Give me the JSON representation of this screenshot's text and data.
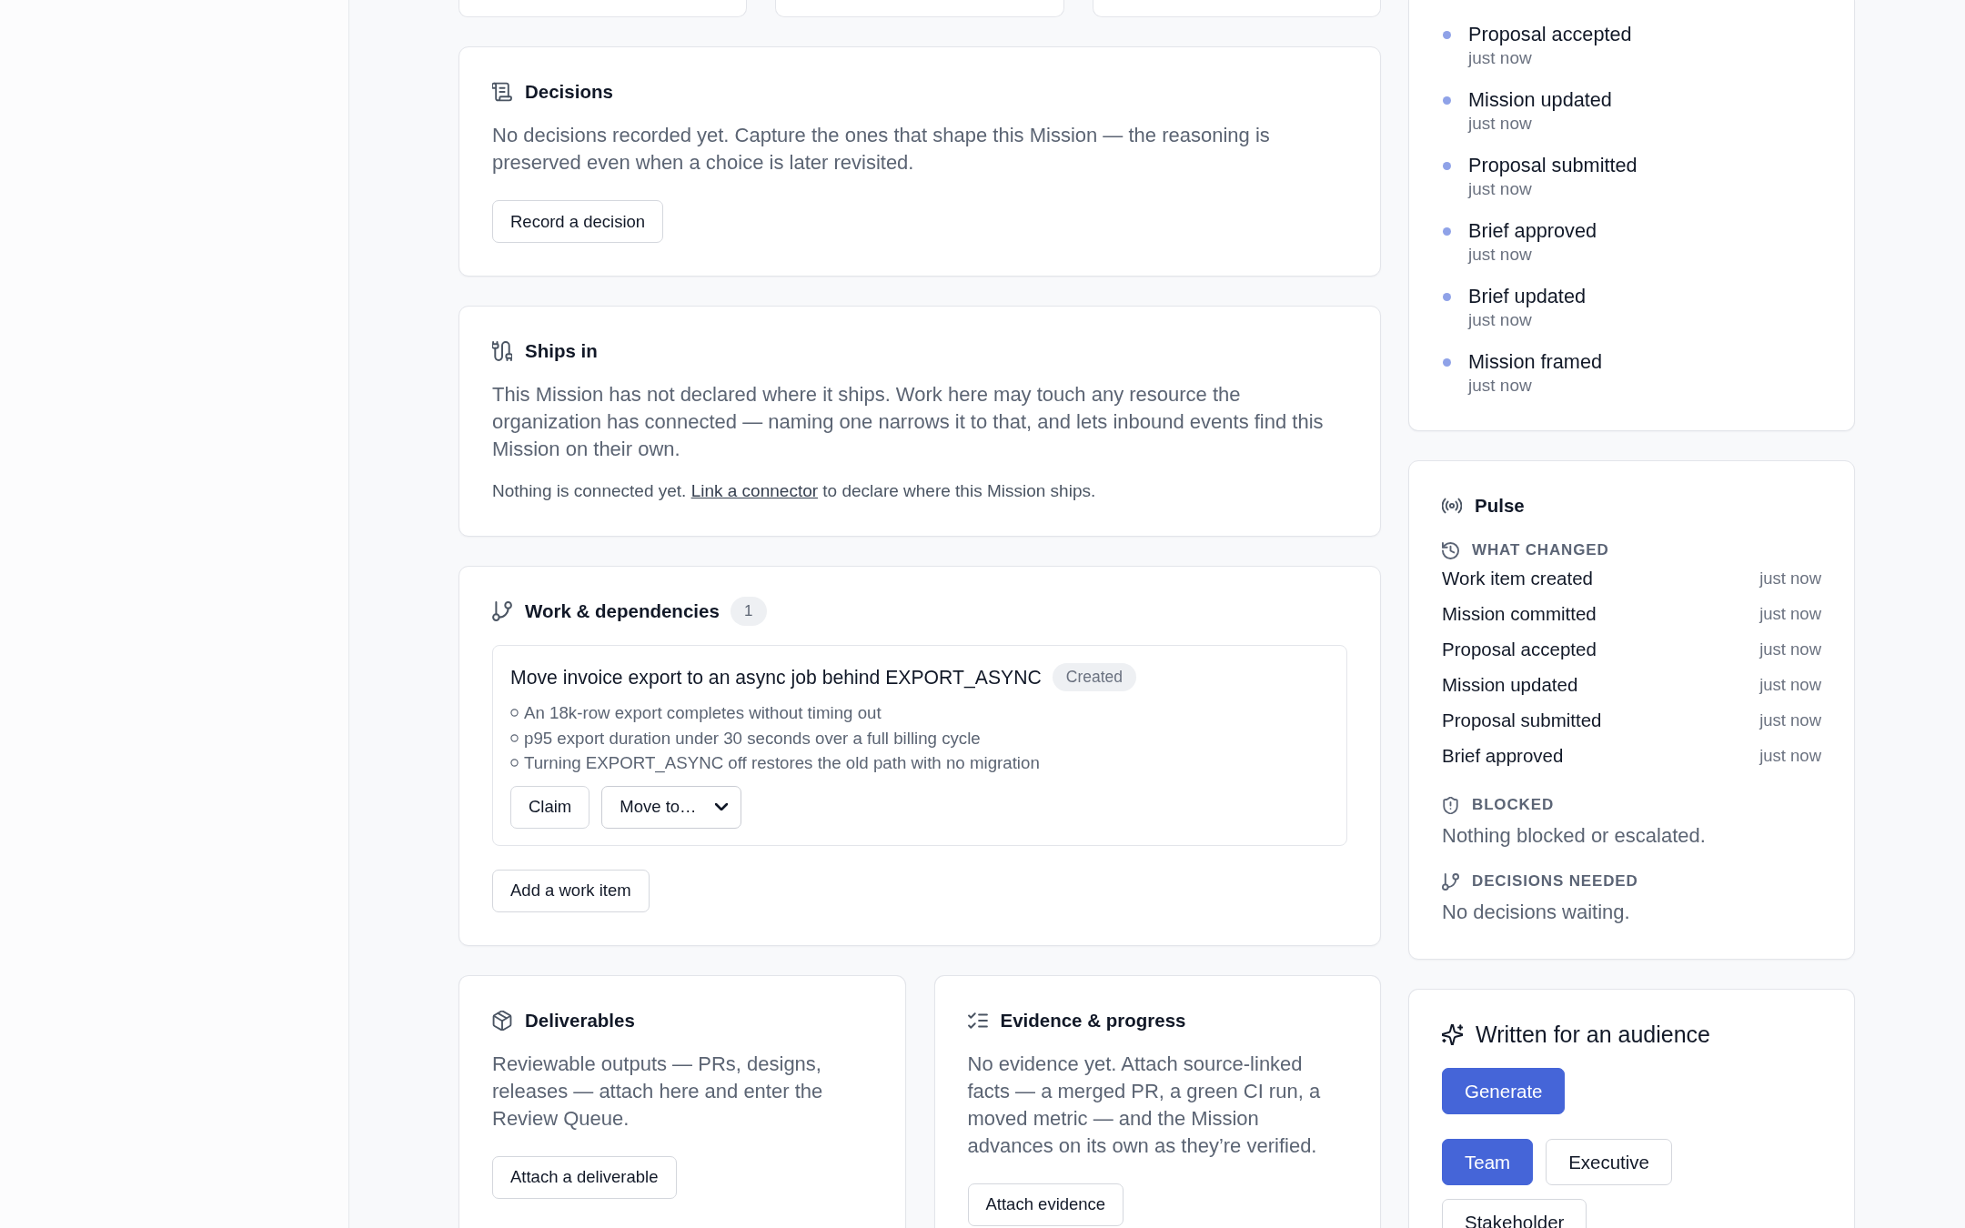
{
  "main": {
    "decisions": {
      "title": "Decisions",
      "text": "No decisions recorded yet. Capture the ones that shape this Mission — the reasoning is preserved even when a choice is later revisited.",
      "button": "Record a decision"
    },
    "ships_in": {
      "title": "Ships in",
      "text": "This Mission has not declared where it ships. Work here may touch any resource the organization has connected — naming one narrows it to that, and lets inbound events find this Mission on their own.",
      "note_before": "Nothing is connected yet.",
      "note_link": "Link a connector",
      "note_after": "to declare where this Mission ships."
    },
    "work": {
      "title": "Work & dependencies",
      "count": "1",
      "items": [
        {
          "title": "Move invoice export to an async job behind EXPORT_ASYNC",
          "status": "Created",
          "criteria": [
            "An 18k-row export completes without timing out",
            "p95 export duration under 30 seconds over a full billing cycle",
            "Turning EXPORT_ASYNC off restores the old path with no migration"
          ],
          "claim_button": "Claim",
          "move_select": "Move to…"
        }
      ],
      "button": "Add a work item"
    },
    "deliverables": {
      "title": "Deliverables",
      "text": "Reviewable outputs — PRs, designs, releases — attach here and enter the Review Queue.",
      "button": "Attach a deliverable"
    },
    "evidence": {
      "title": "Evidence & progress",
      "text": "No evidence yet. Attach source-linked facts — a merged PR, a green CI run, a moved metric — and the Mission advances on its own as they’re verified.",
      "button": "Attach evidence"
    }
  },
  "activity": {
    "events": [
      {
        "title": "Proposal accepted",
        "time": "just now"
      },
      {
        "title": "Mission updated",
        "time": "just now"
      },
      {
        "title": "Proposal submitted",
        "time": "just now"
      },
      {
        "title": "Brief approved",
        "time": "just now"
      },
      {
        "title": "Brief updated",
        "time": "just now"
      },
      {
        "title": "Mission framed",
        "time": "just now"
      }
    ]
  },
  "pulse": {
    "title": "Pulse",
    "sections": [
      {
        "kind": "changes",
        "heading": "WHAT CHANGED",
        "rows": [
          {
            "title": "Work item created",
            "time": "just now"
          },
          {
            "title": "Mission committed",
            "time": "just now"
          },
          {
            "title": "Proposal accepted",
            "time": "just now"
          },
          {
            "title": "Mission updated",
            "time": "just now"
          },
          {
            "title": "Proposal submitted",
            "time": "just now"
          },
          {
            "title": "Brief approved",
            "time": "just now"
          }
        ]
      },
      {
        "kind": "blocked",
        "heading": "BLOCKED",
        "text": "Nothing blocked or escalated."
      },
      {
        "kind": "decisions",
        "heading": "DECISIONS NEEDED",
        "text": "No decisions waiting."
      }
    ]
  },
  "audience": {
    "title": "Written for an audience",
    "generate_button": "Generate",
    "options": [
      {
        "label": "Team",
        "selected": true
      },
      {
        "label": "Executive",
        "selected": false
      },
      {
        "label": "Stakeholder",
        "selected": false
      }
    ]
  }
}
